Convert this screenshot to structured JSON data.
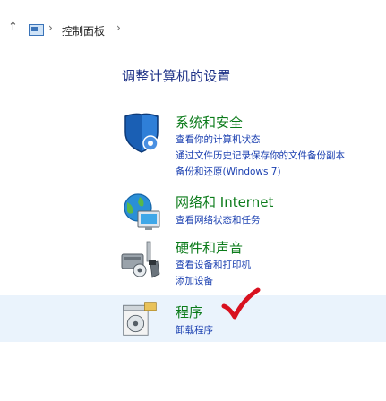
{
  "address_bar": {
    "up_arrow": "↑",
    "icon": "control-panel-icon",
    "separator": "›",
    "crumb": "控制面板",
    "trailing_separator": "›"
  },
  "heading": "调整计算机的设置",
  "categories": [
    {
      "icon": "shield-icon",
      "title": "系统和安全",
      "links": [
        "查看你的计算机状态",
        "通过文件历史记录保存你的文件备份副本",
        "备份和还原(Windows 7)"
      ]
    },
    {
      "icon": "network-globe-icon",
      "title": "网络和 Internet",
      "links": [
        "查看网络状态和任务"
      ]
    },
    {
      "icon": "hardware-sound-icon",
      "title": "硬件和声音",
      "links": [
        "查看设备和打印机",
        "添加设备"
      ]
    },
    {
      "icon": "programs-icon",
      "title": "程序",
      "links": [
        "卸载程序"
      ]
    }
  ],
  "annotation": {
    "icon": "red-checkmark-icon"
  },
  "colors": {
    "heading": "#1e3287",
    "category_title": "#0b7b1a",
    "link": "#1a3fb0",
    "hover_bg": "#eaf3fc",
    "checkmark": "#d8111f"
  }
}
